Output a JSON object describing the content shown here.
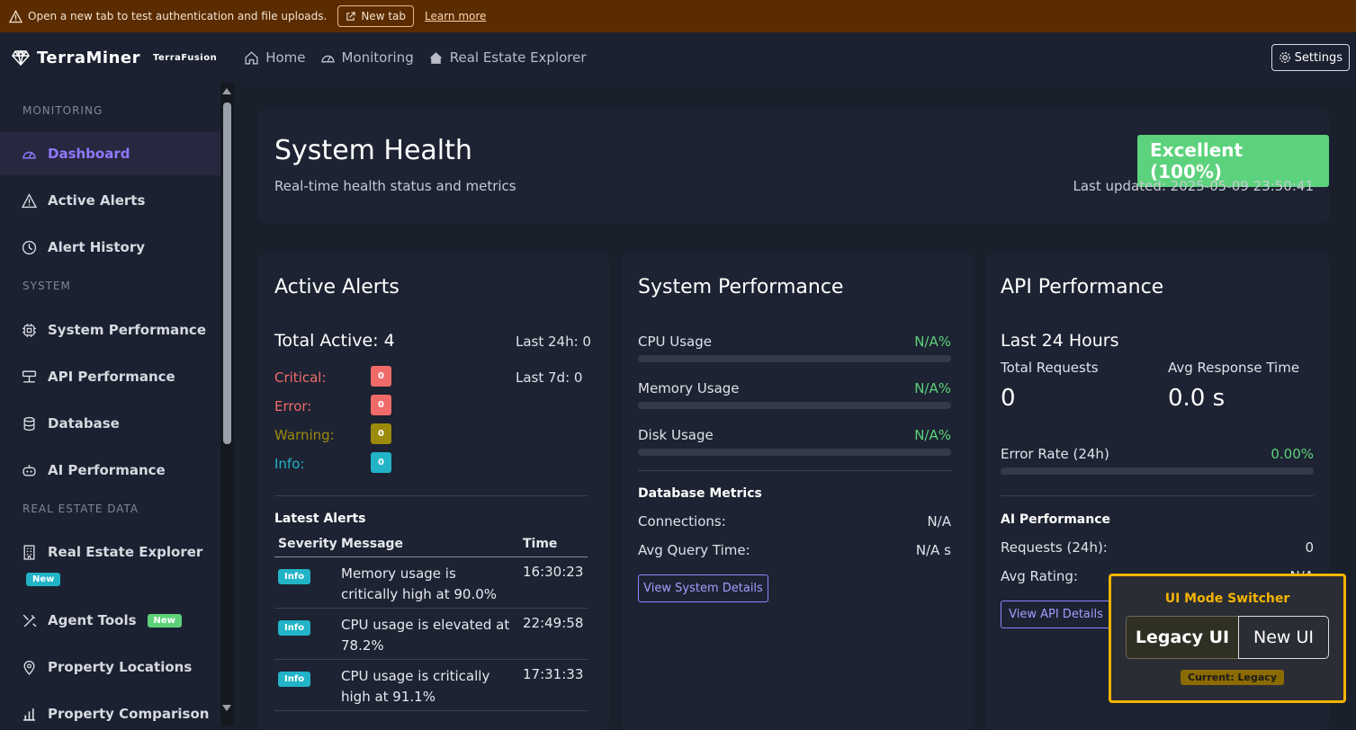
{
  "banner": {
    "text": "Open a new tab to test authentication and file uploads.",
    "new_tab": "New tab",
    "learn_more": "Learn more"
  },
  "topbar": {
    "brand": "TerraMiner",
    "brand_sub": "TerraFusion",
    "nav": [
      "Home",
      "Monitoring",
      "Real Estate Explorer"
    ],
    "settings": "Settings"
  },
  "sidebar": {
    "sec_monitoring": "MONITORING",
    "sec_system": "SYSTEM",
    "sec_realestate": "REAL ESTATE DATA",
    "items": [
      "Dashboard",
      "Active Alerts",
      "Alert History",
      "System Performance",
      "API Performance",
      "Database",
      "AI Performance",
      "Real Estate Explorer",
      "Agent Tools",
      "Property Locations",
      "Property Comparison"
    ],
    "new_badge": "New"
  },
  "health": {
    "title": "System Health",
    "subtitle": "Real-time health status and metrics",
    "status": "Excellent (100%)",
    "last_updated": "Last updated: 2025-05-09 23:50:41"
  },
  "alerts": {
    "title": "Active Alerts",
    "total": "Total Active: 4",
    "last24": "Last 24h: 0",
    "last7": "Last 7d: 0",
    "critical_label": "Critical:",
    "critical": "0",
    "error_label": "Error:",
    "error": "0",
    "warning_label": "Warning:",
    "warning": "0",
    "info_label": "Info:",
    "info": "0",
    "latest_title": "Latest Alerts",
    "headers": [
      "Severity",
      "Message",
      "Time"
    ],
    "rows": [
      {
        "sev": "Info",
        "msg": "Memory usage is critically high at 90.0%",
        "time": "16:30:23"
      },
      {
        "sev": "Info",
        "msg": "CPU usage is elevated at 78.2%",
        "time": "22:49:58"
      },
      {
        "sev": "Info",
        "msg": "CPU usage is critically high at 91.1%",
        "time": "17:31:33"
      }
    ]
  },
  "sysperf": {
    "title": "System Performance",
    "cpu_label": "CPU Usage",
    "cpu": "N/A%",
    "mem_label": "Memory Usage",
    "mem": "N/A%",
    "disk_label": "Disk Usage",
    "disk": "N/A%",
    "db_title": "Database Metrics",
    "conn_label": "Connections:",
    "conn": "N/A",
    "query_label": "Avg Query Time:",
    "query": "N/A s",
    "details": "View System Details"
  },
  "apiperf": {
    "title": "API Performance",
    "period": "Last 24 Hours",
    "req_label": "Total Requests",
    "req": "0",
    "resp_label": "Avg Response Time",
    "resp": "0.0 s",
    "err_label": "Error Rate (24h)",
    "err": "0.00%",
    "ai_title": "AI Performance",
    "ai_req_label": "Requests (24h):",
    "ai_req": "0",
    "ai_rating_label": "Avg Rating:",
    "ai_rating": "N/A",
    "details": "View API Details"
  },
  "switcher": {
    "title": "UI Mode Switcher",
    "legacy": "Legacy UI",
    "new": "New UI",
    "current": "Current: Legacy"
  },
  "colors": {
    "accent": "#8f78ff",
    "critical": "#f16a6a",
    "warning": "#9c8a0b",
    "info": "#22b3c7",
    "good": "#5cd27c"
  }
}
